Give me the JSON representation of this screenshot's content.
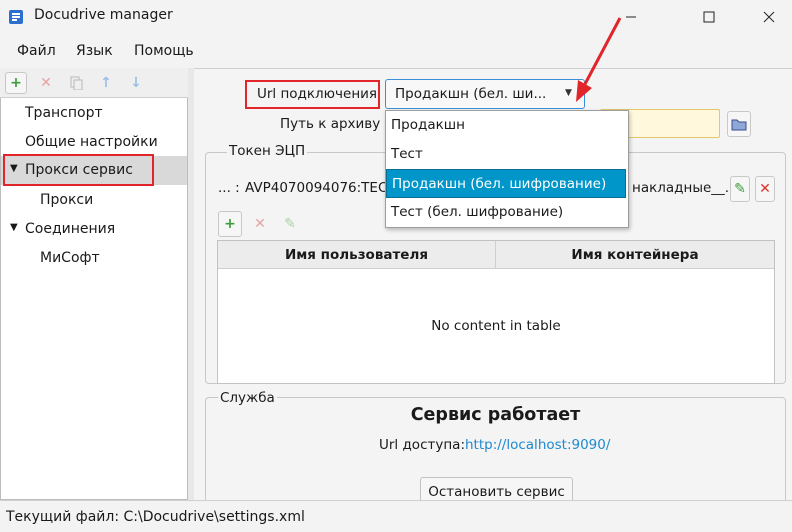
{
  "window": {
    "title": "Docudrive manager"
  },
  "menu": [
    "Файл",
    "Язык",
    "Помощь"
  ],
  "tree": {
    "items": [
      {
        "label": "Транспорт"
      },
      {
        "label": "Общие настройки"
      },
      {
        "label": "Прокси сервис"
      },
      {
        "label": "Прокси"
      },
      {
        "label": "Соединения"
      },
      {
        "label": "МиСофт"
      }
    ]
  },
  "form": {
    "url_label": "Url подключения",
    "url_selected": "Продакшн (бел. ши...",
    "archive_label": "Путь к архиву",
    "archive_value": ""
  },
  "dropdown": {
    "options": [
      "Продакшн",
      "Тест",
      "Продакшн (бел. шифрование)",
      "Тест (бел. шифрование)"
    ],
    "selected_index": 2
  },
  "token": {
    "legend": "Токен ЭЦП",
    "row_prefix": "... :",
    "row_value": "AVP4070094076:ТЕСТ",
    "row_suffix": "накладные__..."
  },
  "table": {
    "columns": [
      "Имя пользователя",
      "Имя контейнера"
    ],
    "empty_text": "No content in table"
  },
  "service": {
    "legend": "Служба",
    "status": "Сервис работает",
    "url_label": "Url доступа:",
    "url_link": "http://localhost:9090/",
    "stop_button": "Остановить сервис"
  },
  "status": {
    "text": "Текущий файл: C:\\Docudrive\\settings.xml"
  },
  "colors": {
    "accent": "#0096c9",
    "highlight_red": "#e0262b",
    "link": "#1e8ad0",
    "add_green": "#3a9d3a",
    "delete_red": "#d9342b"
  }
}
